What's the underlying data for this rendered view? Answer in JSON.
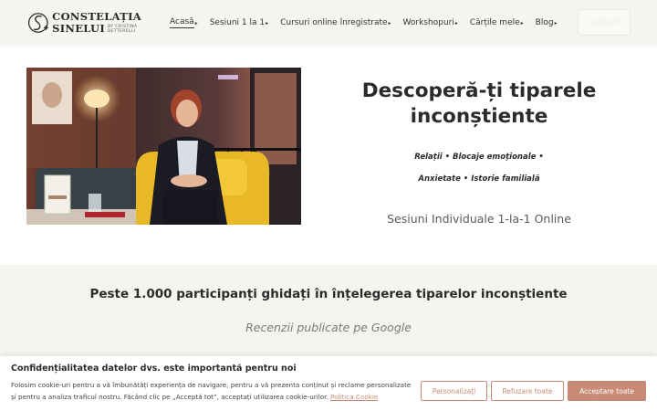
{
  "brand": {
    "logo_line1": "CONSTELAȚIA",
    "logo_line2": "SINELUI",
    "logo_by_1": "BY CRISTINA",
    "logo_by_2": "BETTERELLI"
  },
  "nav": {
    "items": [
      {
        "label": "Acasă",
        "caret": "▸"
      },
      {
        "label": "Sesiuni 1 la 1",
        "caret": "▸"
      },
      {
        "label": "Cursuri online înregistrate",
        "caret": "▸"
      },
      {
        "label": "Workshopuri",
        "caret": "▸"
      },
      {
        "label": "Cărțile mele",
        "caret": "▸"
      },
      {
        "label": "Blog",
        "caret": "▸"
      }
    ],
    "contact_label": "Contact"
  },
  "hero": {
    "title": "Descoperă-ți tiparele inconștiente",
    "tags_line1": "Relații • Blocaje emoționale •",
    "tags_line2": "Anxietate • Istorie familială",
    "subtitle": "Sesiuni Individuale 1-la-1 Online"
  },
  "reviews": {
    "title": "Peste 1.000 participanți ghidați în înțelegerea tiparelor inconștiente",
    "subtitle": "Recenzii publicate pe Google"
  },
  "cookie": {
    "title": "Confidențialitatea datelor dvs. este importantă pentru noi",
    "text": "Folosim cookie-uri pentru a vă îmbunătăți experiența de navigare, pentru a vă prezenta conținut și reclame personalizate și pentru a analiza traficul nostru. Făcând clic pe „Acceptă tot”, acceptați utilizarea cookie-urilor.",
    "link": "Politica Cookie",
    "btn_customize": "Personalizați",
    "btn_reject": "Refuzare toate",
    "btn_accept": "Acceptare toate"
  },
  "colors": {
    "accent": "#c98a75",
    "header_bg": "#f7f5f1",
    "band_bg": "#f6f4ef"
  }
}
